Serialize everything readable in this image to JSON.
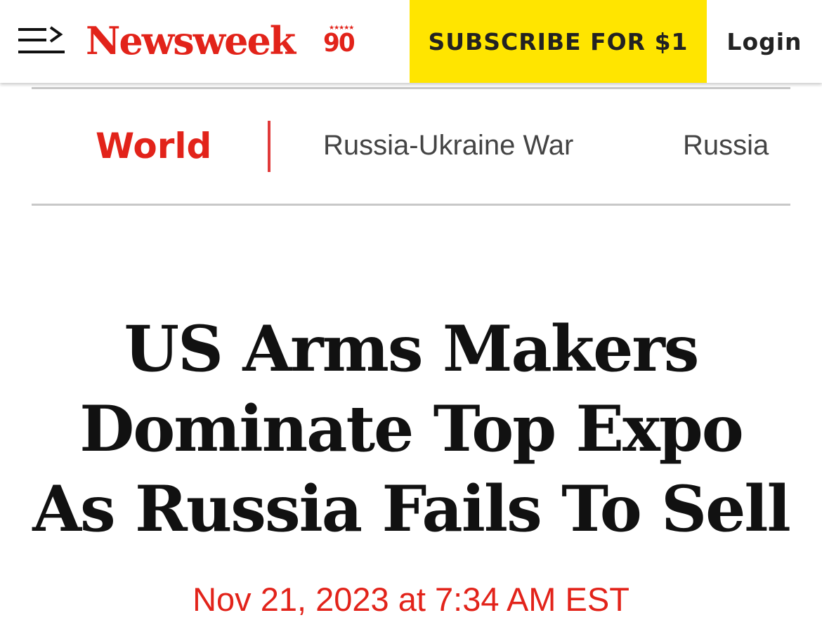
{
  "header": {
    "logo_text": "Newsweek",
    "anniversary_number": "90",
    "anniversary_stars": "★★★★★",
    "subscribe_label": "SUBSCRIBE FOR $1",
    "login_label": "Login",
    "icons": {
      "menu": "menu-arrow-icon"
    }
  },
  "nav": {
    "section": "World",
    "topics": [
      "Russia-Ukraine War",
      "Russia"
    ]
  },
  "article": {
    "headline_lines": [
      "US Arms Makers",
      "Dominate Top Expo",
      "As Russia Fails To Sell"
    ],
    "dateline": "Nov 21, 2023 at 7:34 AM EST"
  },
  "colors": {
    "brand_red": "#e2231a",
    "subscribe_yellow": "#ffe500",
    "divider_red": "#e03a3a",
    "text_dark": "#111111"
  }
}
